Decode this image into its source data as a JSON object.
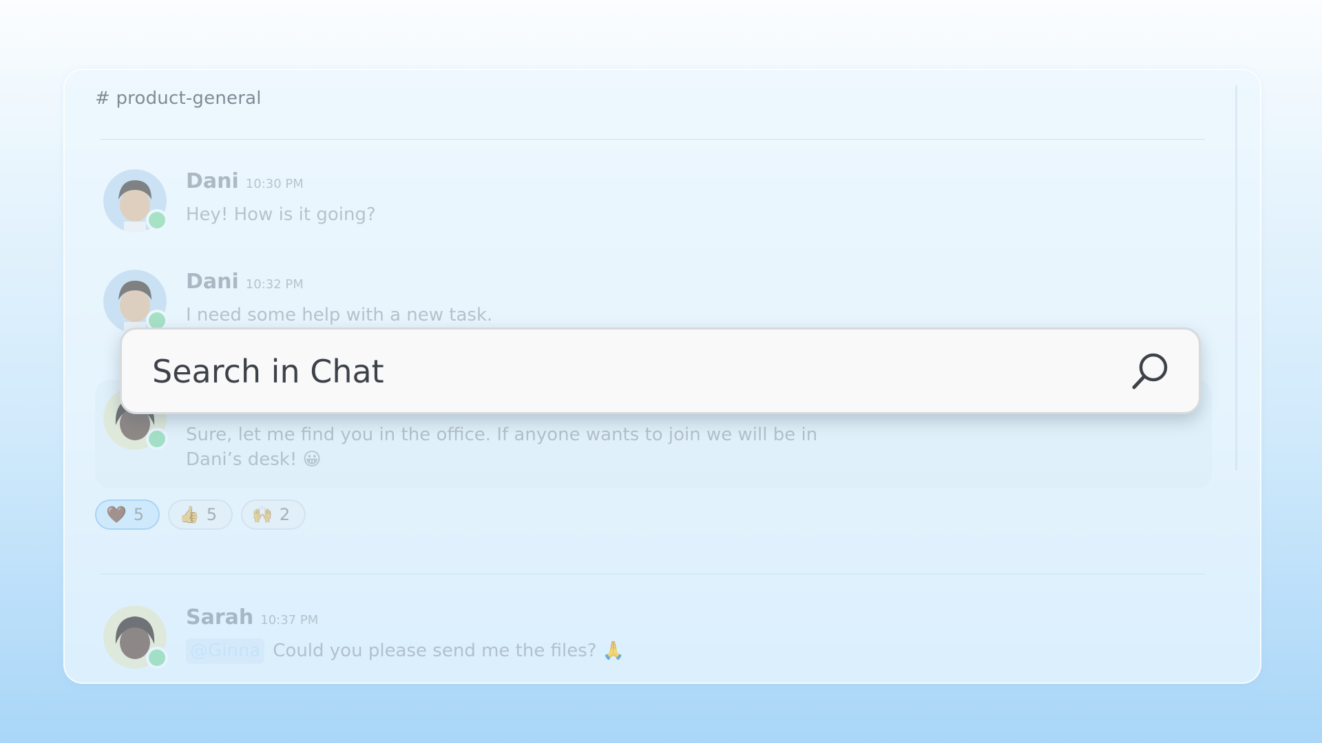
{
  "channel": {
    "name": "# product-general"
  },
  "messages": [
    {
      "author": "Dani",
      "time": "10:30 PM",
      "text": "Hey! How is it going?"
    },
    {
      "author": "Dani",
      "time": "10:32 PM",
      "text": "I need some help with a new task."
    },
    {
      "author": "",
      "time": "",
      "text_line1": "Sure, let me find you in the office. If anyone wants to join we will be in",
      "text_line2": "Dani’s desk! 😀"
    },
    {
      "author": "Sarah",
      "time": "10:37 PM",
      "mention": "@Ginna",
      "text": "Could you please send me the files? 🙏"
    }
  ],
  "reactions": [
    {
      "emoji": "🤎",
      "icon": "heart-icon",
      "count": "5",
      "active": true
    },
    {
      "emoji": "👍",
      "icon": "thumbs-up-icon",
      "count": "5",
      "active": false
    },
    {
      "emoji": "🙌",
      "icon": "raised-hands-icon",
      "count": "2",
      "active": false
    }
  ],
  "search": {
    "placeholder": "Search in Chat",
    "icon": "search-icon"
  },
  "colors": {
    "online": "#7fd6a6",
    "mention_bg": "#cde6fa"
  }
}
